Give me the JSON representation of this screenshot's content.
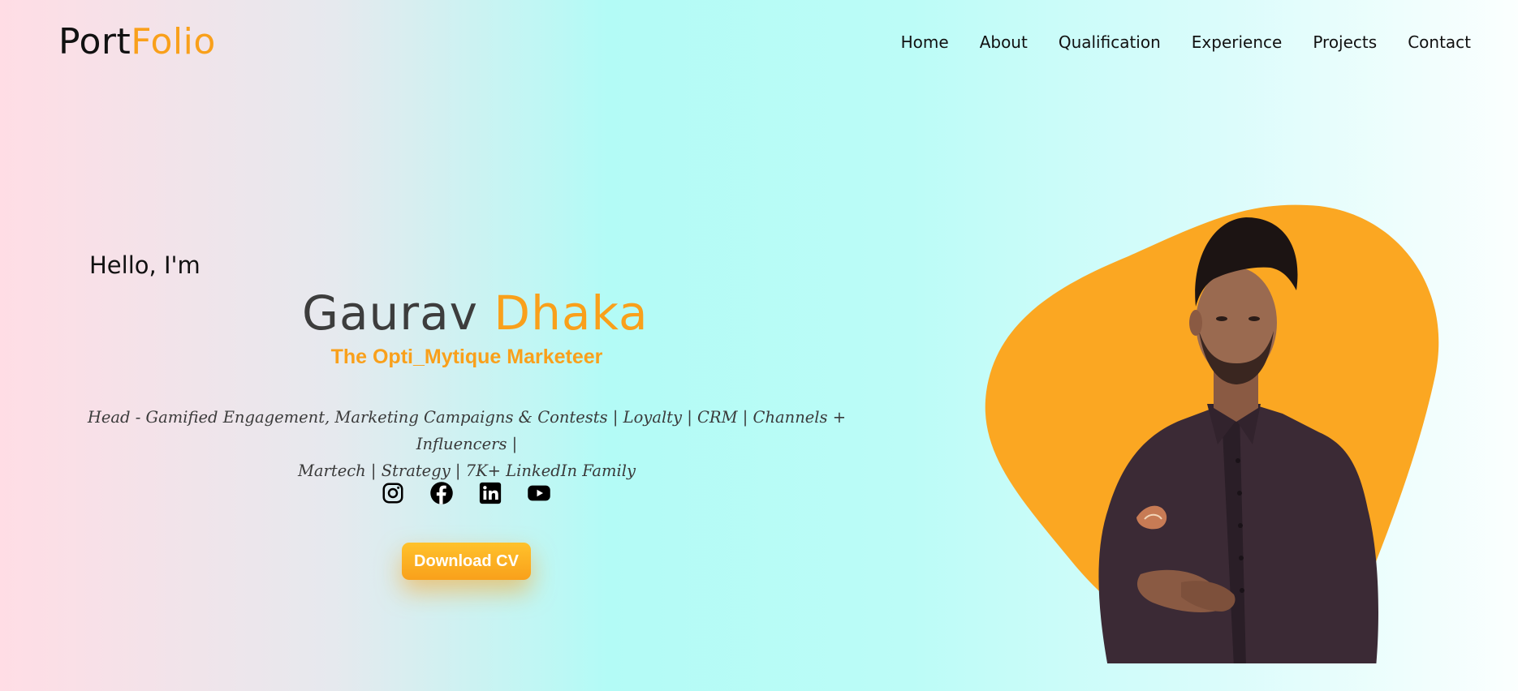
{
  "logo": {
    "part1": "Port",
    "part2": "Folio"
  },
  "nav": [
    "Home",
    "About",
    "Qualification",
    "Experience",
    "Projects",
    "Contact"
  ],
  "hero": {
    "greeting": "Hello, I'm",
    "first_name": "Gaurav",
    "last_name": "Dhaka",
    "tagline": "The Opti_Mytique Marketeer",
    "description_line1": "Head - Gamified Engagement, Marketing Campaigns & Contests | Loyalty | CRM | Channels + Influencers |",
    "description_line2": "Martech | Strategy | 7K+ LinkedIn Family",
    "cv_button": "Download CV"
  },
  "socials": [
    {
      "icon": "instagram-icon"
    },
    {
      "icon": "facebook-icon"
    },
    {
      "icon": "linkedin-icon"
    },
    {
      "icon": "youtube-icon"
    }
  ],
  "colors": {
    "accent": "#f9a01b",
    "text": "#111111",
    "name_dark": "#3d3d3d"
  }
}
